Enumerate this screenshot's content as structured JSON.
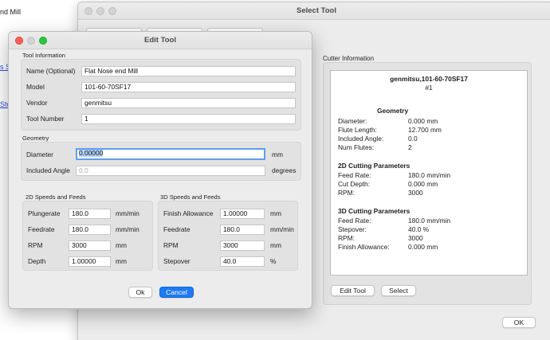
{
  "background": {
    "line1": "nd Mill",
    "link1": "s S",
    "link2": "Sto"
  },
  "select_tool": {
    "title": "Select Tool",
    "cutter_info_label": "Cutter Information",
    "cutter": {
      "name": "genmitsu,101-60-70SF17",
      "number": "#1",
      "geometry_heading": "Geometry",
      "geometry": [
        {
          "k": "Diameter:",
          "v": "0.000 mm"
        },
        {
          "k": "Flute Length:",
          "v": "12.700 mm"
        },
        {
          "k": "Included Angle:",
          "v": "0.0"
        },
        {
          "k": "Num Flutes:",
          "v": "2"
        }
      ],
      "params2d_heading": "2D Cutting Parameters",
      "params2d": [
        {
          "k": "Feed Rate:",
          "v": "180.0 mm/min"
        },
        {
          "k": "Cut Depth:",
          "v": "0.000 mm"
        },
        {
          "k": "RPM:",
          "v": "3000"
        }
      ],
      "params3d_heading": "3D Cutting Parameters",
      "params3d": [
        {
          "k": "Feed Rate:",
          "v": "180.0 mm/min"
        },
        {
          "k": "Stepover:",
          "v": "40.0 %"
        },
        {
          "k": "RPM:",
          "v": "3000"
        },
        {
          "k": "Finish Allowance:",
          "v": "0.000 mm"
        }
      ]
    },
    "edit_tool_button": "Edit Tool",
    "select_button": "Select",
    "ok_button": "OK"
  },
  "edit_tool": {
    "title": "Edit Tool",
    "tool_info_label": "Tool Information",
    "name_label": "Name (Optional)",
    "name_value": "Flat Nose end Mill",
    "model_label": "Model",
    "model_value": "101-60-70SF17",
    "vendor_label": "Vendor",
    "vendor_value": "genmitsu",
    "tool_number_label": "Tool Number",
    "tool_number_value": "1",
    "geometry_label": "Geometry",
    "diameter_label": "Diameter",
    "diameter_value": "0.00000",
    "diameter_unit": "mm",
    "included_angle_label": "Included Angle",
    "included_angle_value": "0.0",
    "included_angle_unit": "degrees",
    "speeds2d_label": "2D Speeds and Feeds",
    "plungerate_label": "Plungerate",
    "plungerate_value": "180.0",
    "plungerate_unit": "mm/min",
    "feedrate_label": "Feedrate",
    "feedrate_value": "180.0",
    "feedrate_unit": "mm/min",
    "rpm_label": "RPM",
    "rpm_value": "3000",
    "rpm_unit": "mm",
    "depth_label": "Depth",
    "depth_value": "1.00000",
    "depth_unit": "mm",
    "speeds3d_label": "3D Speeds and Feeds",
    "finish_allowance_label": "Finish Allowance",
    "finish_allowance_value": "1.00000",
    "finish_allowance_unit": "mm",
    "feedrate3d_label": "Feedrate",
    "feedrate3d_value": "180.0",
    "feedrate3d_unit": "mm/min",
    "rpm3d_label": "RPM",
    "rpm3d_value": "3000",
    "rpm3d_unit": "mm",
    "stepover_label": "Stepover",
    "stepover_value": "40.0",
    "stepover_unit": "%",
    "ok_button": "Ok",
    "cancel_button": "Cancel"
  },
  "colors": {
    "accent": "#1d7af5",
    "link": "#2a4bd8",
    "hatch": "#a43d6f"
  }
}
